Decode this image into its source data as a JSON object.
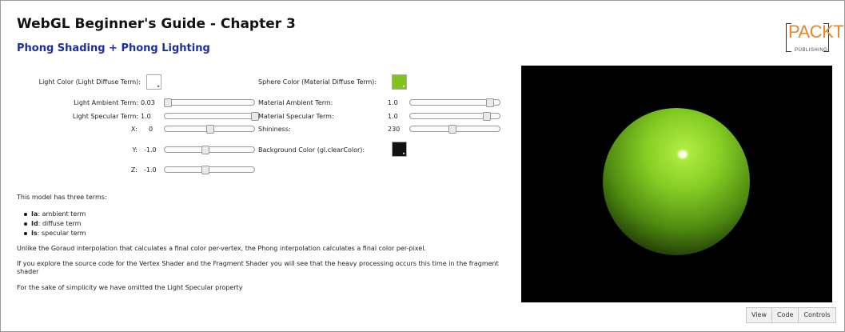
{
  "header": {
    "title": "WebGL Beginner's Guide - Chapter 3",
    "subtitle": "Phong Shading + Phong Lighting",
    "logo": {
      "word": "PACKT",
      "sub": "PUBLISHING"
    }
  },
  "controls": {
    "light_color_label": "Light Color (Light Diffuse Term):",
    "light_color": "#ffffff",
    "light_ambient": {
      "label": "Light Ambient Term:",
      "value": "0.03",
      "level": 0.03
    },
    "light_specular": {
      "label": "Light Specular Term:",
      "value": "1.0",
      "level": 1.0
    },
    "x": {
      "label": "X:",
      "value": "0",
      "level": 0.5
    },
    "y": {
      "label": "Y:",
      "value": "-1.0",
      "level": 0.45
    },
    "z": {
      "label": "Z:",
      "value": "-1.0",
      "level": 0.45
    },
    "sphere_color_label": "Sphere Color (Material Diffuse Term):",
    "sphere_color": "#7fc31c",
    "material_ambient": {
      "label": "Material Ambient Term:",
      "value": "1.0",
      "level": 0.88
    },
    "material_specular": {
      "label": "Material Specular Term:",
      "value": "1.0",
      "level": 0.85
    },
    "shininess": {
      "label": "Shininess:",
      "value": "230",
      "level": 0.46
    },
    "background_label": "Background Color (gl.clearColor):",
    "background_color": "#111111"
  },
  "description": {
    "intro": "This model has three terms:",
    "terms": [
      {
        "key": "Ia",
        "text": ": ambient term"
      },
      {
        "key": "Id",
        "text": ": diffuse term"
      },
      {
        "key": "Is",
        "text": ": specular term"
      }
    ],
    "p1": "Unlike the Goraud interpolation that calculates a final color per-vertex, the Phong interpolation calculates a final color per-pixel.",
    "p2a": "If you explore the source code for the Vertex Shader and the Fragment Shader you will see that the heavy processing occurs this time in the fragment",
    "p2b": "shader",
    "p3": "For the sake of simplicity we have omitted the Light Specular property"
  },
  "viewer": {
    "buttons": [
      "View",
      "Code",
      "Controls"
    ]
  },
  "colors": {
    "title": "#1a2f9a",
    "logo": "#e8862a",
    "canvas_bg": "#000000"
  }
}
